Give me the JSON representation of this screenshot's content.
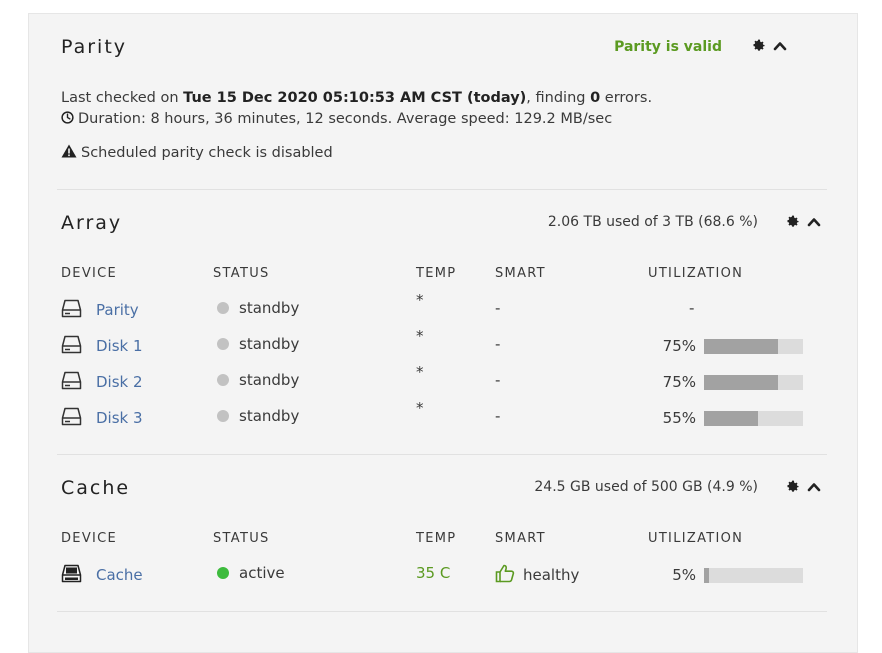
{
  "parity": {
    "title": "Parity",
    "status": "Parity is valid",
    "last_checked_prefix": "Last checked on ",
    "last_checked_date": "Tue 15 Dec 2020 05:10:53 AM CST (today)",
    "finding_prefix": ", finding ",
    "errors_count": "0",
    "errors_suffix": " errors.",
    "duration": "Duration: 8 hours, 36 minutes, 12 seconds. Average speed: 129.2 MB/sec",
    "schedule_warning": "Scheduled parity check is disabled"
  },
  "array": {
    "title": "Array",
    "usage": "2.06 TB used of 3 TB (68.6 %)",
    "headers": {
      "device": "DEVICE",
      "status": "STATUS",
      "temp": "TEMP",
      "smart": "SMART",
      "utilization": "UTILIZATION"
    },
    "rows": [
      {
        "device": "Parity",
        "status": "standby",
        "temp": "*",
        "smart": "-",
        "utilization": "-",
        "fill": null
      },
      {
        "device": "Disk 1",
        "status": "standby",
        "temp": "*",
        "smart": "-",
        "utilization": "75%",
        "fill": 0.75
      },
      {
        "device": "Disk 2",
        "status": "standby",
        "temp": "*",
        "smart": "-",
        "utilization": "75%",
        "fill": 0.75
      },
      {
        "device": "Disk 3",
        "status": "standby",
        "temp": "*",
        "smart": "-",
        "utilization": "55%",
        "fill": 0.55
      }
    ]
  },
  "cache": {
    "title": "Cache",
    "usage": "24.5 GB used of 500 GB (4.9 %)",
    "headers": {
      "device": "DEVICE",
      "status": "STATUS",
      "temp": "TEMP",
      "smart": "SMART",
      "utilization": "UTILIZATION"
    },
    "rows": [
      {
        "device": "Cache",
        "status": "active",
        "temp": "35 C",
        "smart": "healthy",
        "utilization": "5%",
        "fill": 0.05
      }
    ]
  },
  "colors": {
    "ok_green": "#5b9a21",
    "active_green": "#3dbb3d",
    "standby_grey": "#c2c2c2",
    "link_blue": "#4a6fa5",
    "bar_fill": "#a2a2a2",
    "bar_track": "#dcdcdc"
  },
  "icons": {
    "settings": "gear-icon",
    "collapse": "chevron-up-icon",
    "clock": "clock-icon",
    "warning": "warning-icon",
    "hdd": "hdd-icon",
    "ssd": "ssd-icon",
    "smart_ok": "thumbs-up-icon"
  }
}
